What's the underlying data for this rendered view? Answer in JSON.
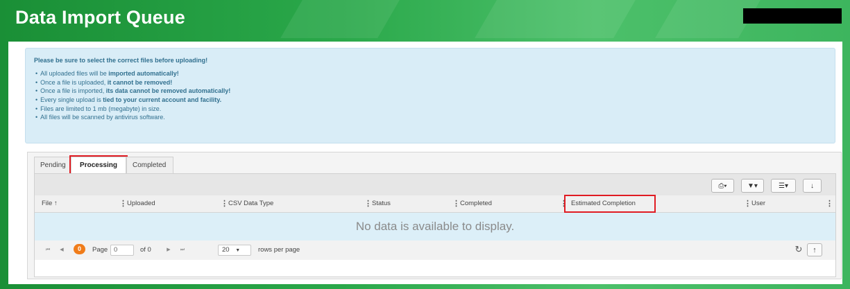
{
  "page": {
    "title": "Data Import Queue"
  },
  "alert": {
    "title": "Please be sure to select the correct files before uploading!",
    "items": [
      {
        "pre": "All uploaded files will be ",
        "bold": "imported automatically!",
        "post": ""
      },
      {
        "pre": "Once a file is uploaded, ",
        "bold": "it cannot be removed!",
        "post": ""
      },
      {
        "pre": "Once a file is imported, ",
        "bold": "its data cannot be removed automatically!",
        "post": ""
      },
      {
        "pre": "Every single upload is ",
        "bold": "tied to your current account and facility.",
        "post": ""
      },
      {
        "pre": "Files are limited to 1 mb (megabyte) in size.",
        "bold": "",
        "post": ""
      },
      {
        "pre": "All files will be scanned by antivirus software.",
        "bold": "",
        "post": ""
      }
    ]
  },
  "tabs": [
    {
      "label": "Pending",
      "active": false
    },
    {
      "label": "Processing",
      "active": true
    },
    {
      "label": "Completed",
      "active": false
    }
  ],
  "toolbar": {
    "buttons": [
      {
        "name": "print-menu-button",
        "icon": "printer-icon",
        "glyph": "⎙▾"
      },
      {
        "name": "filter-menu-button",
        "icon": "filter-icon",
        "glyph": "▼▾"
      },
      {
        "name": "columns-menu-button",
        "icon": "menu-icon",
        "glyph": "☰▾"
      },
      {
        "name": "download-button",
        "icon": "download-icon",
        "glyph": "↓"
      }
    ]
  },
  "table": {
    "columns": [
      {
        "label": "File",
        "sort": "↑"
      },
      {
        "label": "Uploaded"
      },
      {
        "label": "CSV Data Type"
      },
      {
        "label": "Status"
      },
      {
        "label": "Completed"
      },
      {
        "label": "Estimated Completion"
      },
      {
        "label": "User"
      }
    ],
    "empty_message": "No data is available to display."
  },
  "pager": {
    "current_page": "0",
    "page_label": "Page",
    "page_input": "0",
    "of_label": "of 0",
    "page_size": "20",
    "rows_label": "rows per page"
  },
  "colors": {
    "banner": "#2aa84a",
    "alert_bg": "#d9edf7",
    "alert_text": "#31708f",
    "highlight": "#e01b22",
    "pager_badge": "#f07c1a"
  }
}
